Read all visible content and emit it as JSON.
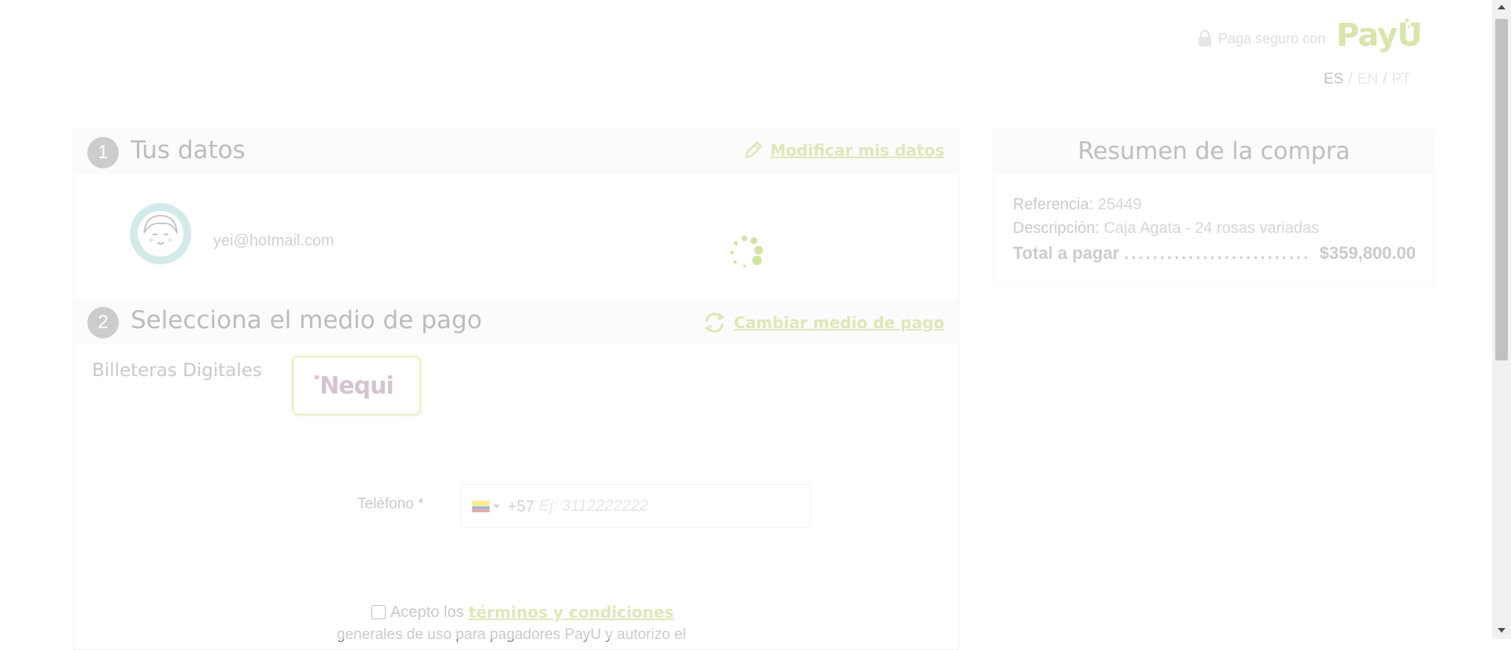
{
  "header": {
    "secure_label": "Paga seguro con",
    "brand": "PayU",
    "languages": [
      {
        "code": "ES",
        "selected": true
      },
      {
        "code": "EN",
        "selected": false
      },
      {
        "code": "PT",
        "selected": false
      }
    ],
    "separator": "/"
  },
  "step1": {
    "number": "1",
    "title": "Tus datos",
    "action_label": "Modificar mis datos",
    "action_icon": "pencil-icon",
    "email": "yei@hotmail.com",
    "loading": true
  },
  "step2": {
    "number": "2",
    "title": "Selecciona el medio de pago",
    "action_label": "Cambiar medio de pago",
    "action_icon": "refresh-icon",
    "category_label": "Billeteras Digitales",
    "selected_wallet": "Nequi",
    "phone": {
      "label": "Teléfono *",
      "country_code": "+57",
      "placeholder": "Ej: 3112222222",
      "value": ""
    },
    "terms": {
      "checked": false,
      "prefix": "Acepto los",
      "link": "términos y condiciones",
      "line2": "generales de uso para pagadores PayU y autorizo el"
    }
  },
  "summary": {
    "title": "Resumen de la compra",
    "reference_label": "Referencia:",
    "reference_value": "25449",
    "description_label": "Descripción:",
    "description_value": "Caja Agata - 24 rosas variadas",
    "total_label": "Total a pagar",
    "total_value": "$359,800.00"
  },
  "colors": {
    "accent": "#b6cc62",
    "header_bg": "#f6f6f6",
    "step_circle": "#8e8e8e",
    "avatar_bg": "#9ed3cc"
  }
}
